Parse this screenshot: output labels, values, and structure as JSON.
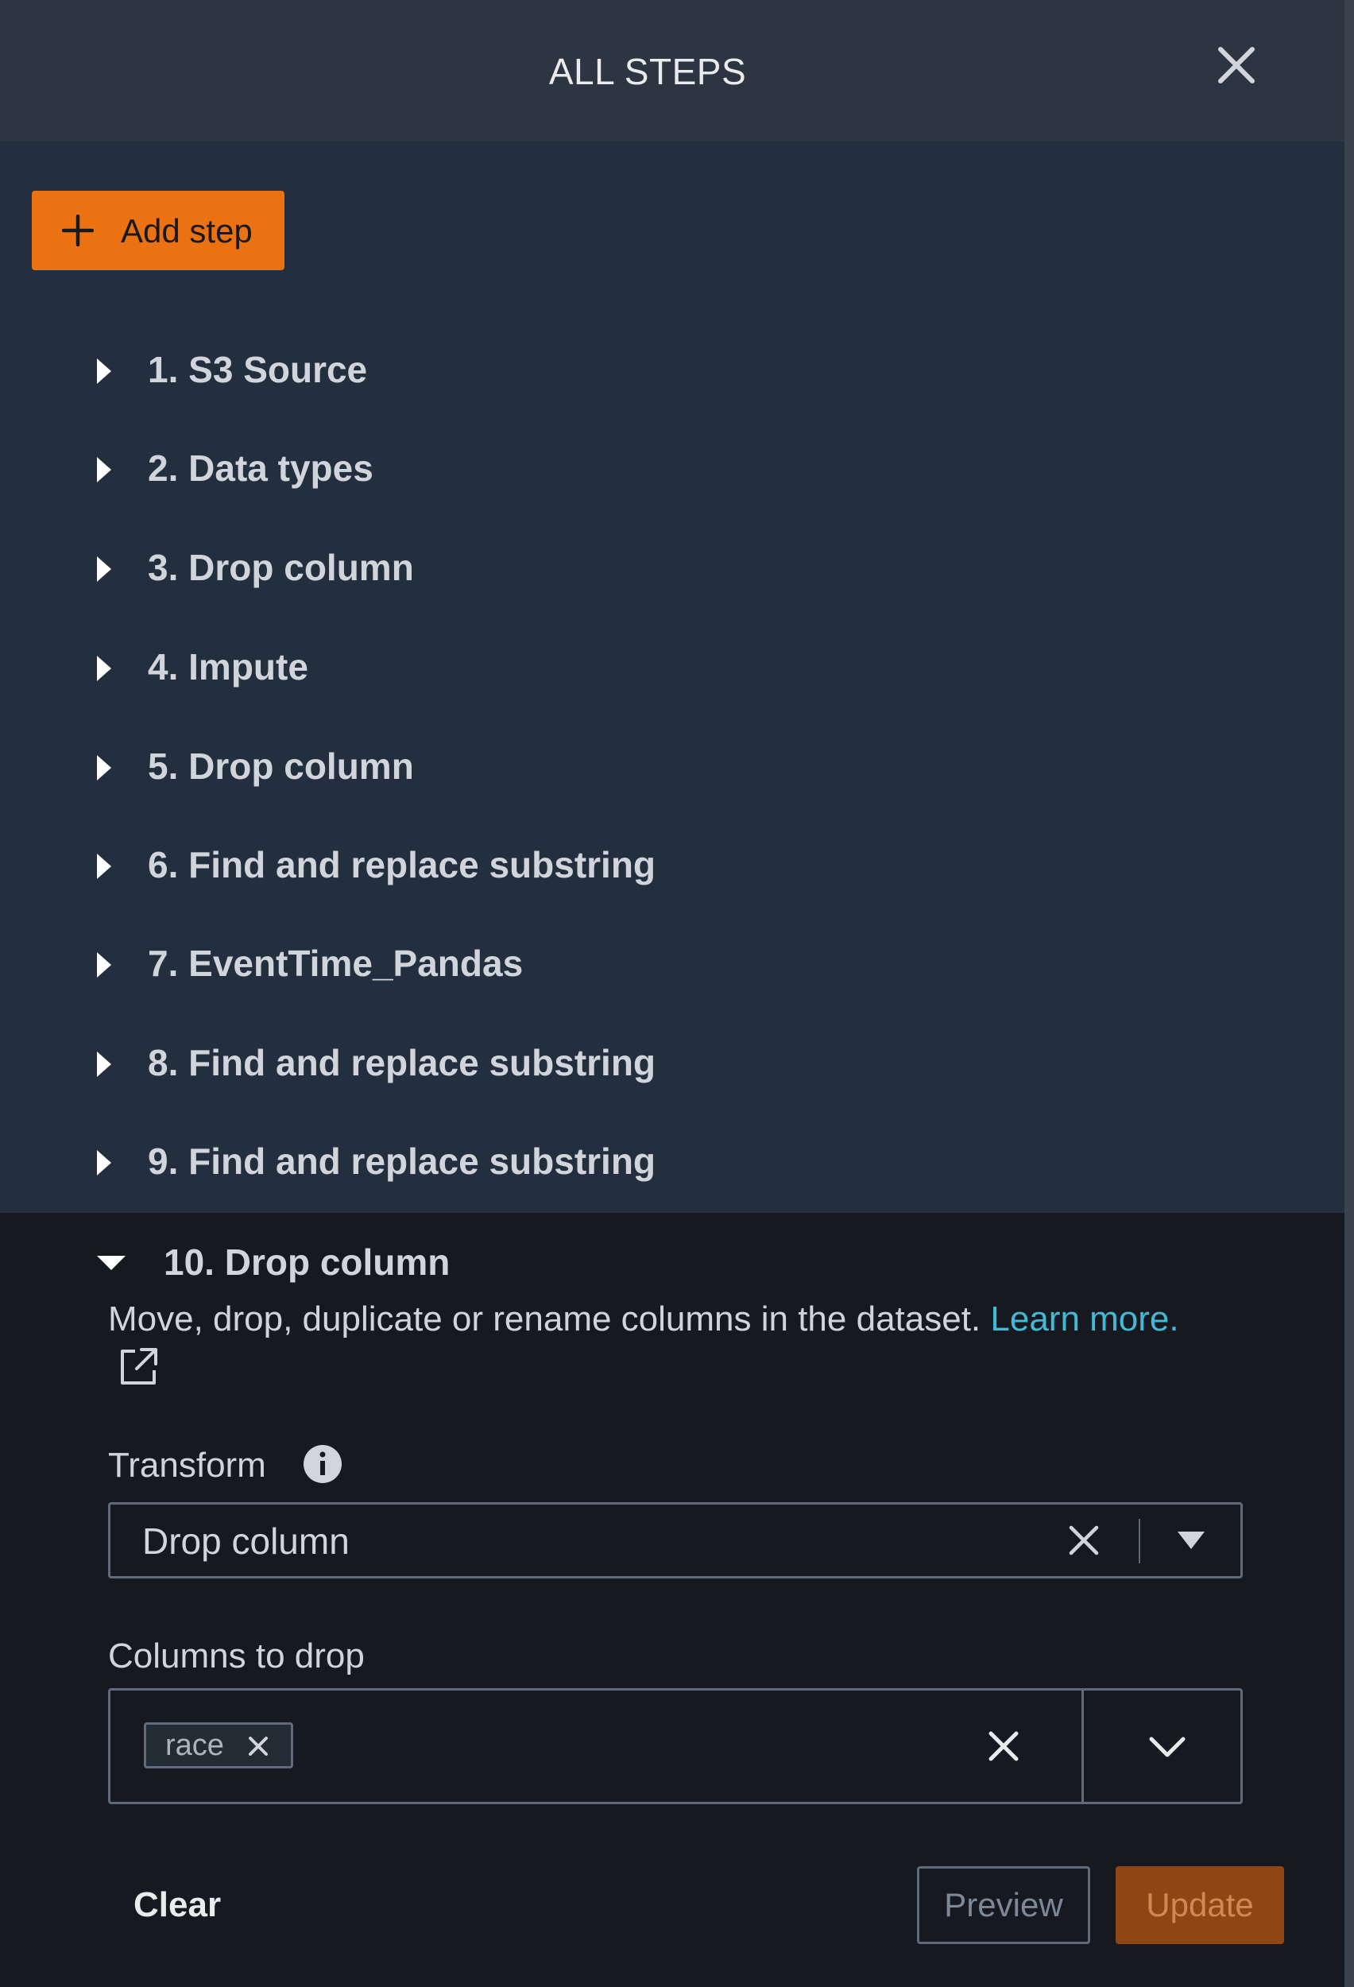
{
  "header": {
    "title": "ALL STEPS",
    "close_icon": "close-icon"
  },
  "toolbar": {
    "add_step_label": "Add step",
    "add_step_icon": "plus-icon",
    "accent_color": "#ec7211"
  },
  "steps": [
    {
      "label": "1. S3 Source",
      "expanded": false
    },
    {
      "label": "2. Data types",
      "expanded": false
    },
    {
      "label": "3. Drop column",
      "expanded": false
    },
    {
      "label": "4. Impute",
      "expanded": false
    },
    {
      "label": "5. Drop column",
      "expanded": false
    },
    {
      "label": "6. Find and replace substring",
      "expanded": false
    },
    {
      "label": "7. EventTime_Pandas",
      "expanded": false
    },
    {
      "label": "8. Find and replace substring",
      "expanded": false
    },
    {
      "label": "9. Find and replace substring",
      "expanded": false
    }
  ],
  "expanded_step": {
    "label": "10. Drop column",
    "expanded": true,
    "description": "Move, drop, duplicate or rename columns in the dataset.",
    "learn_more": "Learn more.",
    "link_color": "#44b9d6",
    "transform": {
      "label": "Transform",
      "value": "Drop column",
      "info_icon": "info-icon"
    },
    "columns_to_drop": {
      "label": "Columns to drop",
      "selected": [
        "race"
      ]
    },
    "actions": {
      "clear": "Clear",
      "preview": "Preview",
      "update": "Update"
    }
  }
}
